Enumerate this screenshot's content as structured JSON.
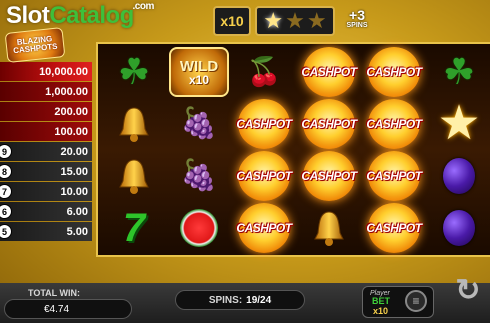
{
  "watermark": {
    "part1": "Slot",
    "part2": "Catalog",
    "suffix": ".com"
  },
  "logo": {
    "text": "BLAZING CASHPOTS"
  },
  "top_bar": {
    "multiplier": "x10",
    "stars_lit": 1,
    "stars_total": 3,
    "extra_spins": "+3",
    "extra_spins_label": "SPINS"
  },
  "paytable": [
    {
      "count": "",
      "value": "10,000.00"
    },
    {
      "count": "",
      "value": "1,000.00"
    },
    {
      "count": "",
      "value": "200.00"
    },
    {
      "count": "",
      "value": "100.00"
    },
    {
      "count": "9",
      "value": "20.00"
    },
    {
      "count": "8",
      "value": "15.00"
    },
    {
      "count": "7",
      "value": "10.00"
    },
    {
      "count": "6",
      "value": "6.00"
    },
    {
      "count": "5",
      "value": "5.00"
    }
  ],
  "reels": [
    [
      "clover",
      "bell",
      "bell",
      "seven"
    ],
    [
      "wild",
      "grapes",
      "grapes",
      "melon"
    ],
    [
      "cherries",
      "cashpot",
      "cashpot",
      "cashpot"
    ],
    [
      "cashpot",
      "cashpot",
      "cashpot",
      "bell"
    ],
    [
      "cashpot",
      "cashpot",
      "cashpot",
      "cashpot"
    ],
    [
      "clover",
      "star",
      "plum",
      "plum"
    ]
  ],
  "symbols": {
    "cashpot_text": "CASHPOT",
    "wild_text": "WILD",
    "wild_multiplier": "x10",
    "seven_text": "7"
  },
  "bottom_bar": {
    "total_win_label": "TOTAL WIN:",
    "total_win_value": "€4.74",
    "spins_label": "SPINS:",
    "spins_value": "19/24",
    "bet_label_small": "Player",
    "bet_label": "BET",
    "bet_multiplier": "x10"
  },
  "colors": {
    "accent_gold": "#e8c34a",
    "paytable_red": "#a00b0b",
    "brand_green": "#3fbf3a"
  }
}
